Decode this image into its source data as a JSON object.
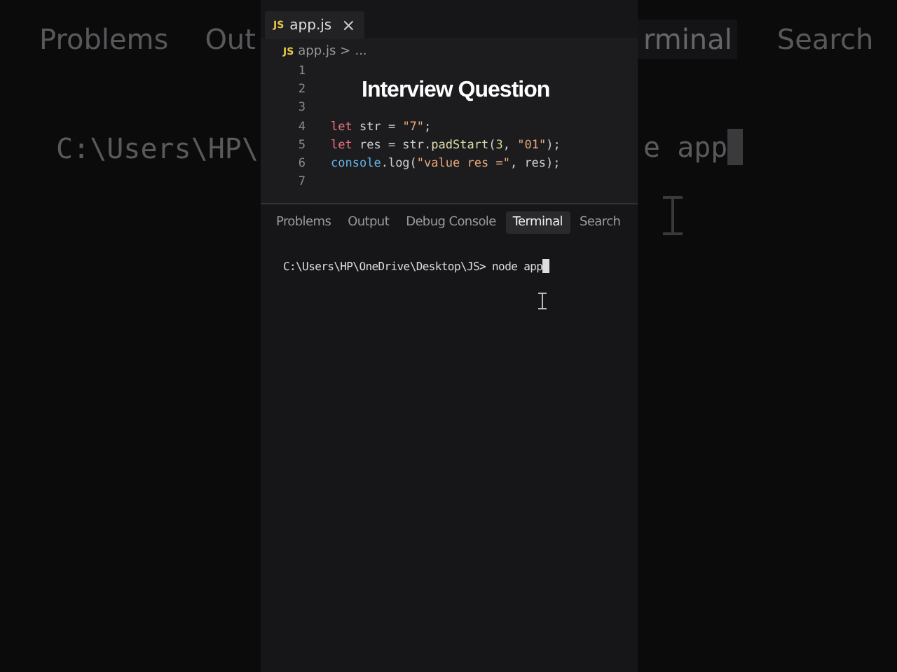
{
  "background_left": {
    "tabs": [
      "Problems",
      "Out"
    ],
    "terminal_line": "C:\\Users\\HP\\"
  },
  "background_right": {
    "tabs": [
      {
        "label": "rminal",
        "selected": true
      },
      {
        "label": "Search",
        "selected": false
      }
    ],
    "terminal_line": "e app"
  },
  "editor_tab": {
    "icon": "JS",
    "label": "app.js",
    "close": "×"
  },
  "breadcrumb": {
    "icon": "JS",
    "file": "app.js",
    "separator": ">",
    "rest": "..."
  },
  "code_lines": [
    {
      "number": "1"
    },
    {
      "number": "2"
    },
    {
      "number": "3"
    },
    {
      "number": "4",
      "tokens": [
        {
          "kind": "keyword",
          "text": "let"
        },
        {
          "kind": "plain",
          "text": " str = "
        },
        {
          "kind": "string",
          "text": "\"7\""
        },
        {
          "kind": "plain",
          "text": ";"
        }
      ]
    },
    {
      "number": "5",
      "tokens": [
        {
          "kind": "keyword",
          "text": "let"
        },
        {
          "kind": "plain",
          "text": " res = str."
        },
        {
          "kind": "function",
          "text": "padStart"
        },
        {
          "kind": "plain",
          "text": "("
        },
        {
          "kind": "number",
          "text": "3"
        },
        {
          "kind": "plain",
          "text": ", "
        },
        {
          "kind": "string",
          "text": "\"01\""
        },
        {
          "kind": "plain",
          "text": ");"
        }
      ]
    },
    {
      "number": "6",
      "tokens": [
        {
          "kind": "builtin",
          "text": "console"
        },
        {
          "kind": "plain",
          "text": ".log("
        },
        {
          "kind": "string",
          "text": "\"value res =\""
        },
        {
          "kind": "plain",
          "text": ", res);"
        }
      ]
    },
    {
      "number": "7"
    }
  ],
  "caption": "Interview Question",
  "panel_tabs": [
    {
      "label": "Problems",
      "selected": false
    },
    {
      "label": "Output",
      "selected": false
    },
    {
      "label": "Debug Console",
      "selected": false
    },
    {
      "label": "Terminal",
      "selected": true
    },
    {
      "label": "Search",
      "selected": false
    }
  ],
  "terminal": {
    "prompt": "C:\\Users\\HP\\OneDrive\\Desktop\\JS>",
    "command": "node app"
  }
}
